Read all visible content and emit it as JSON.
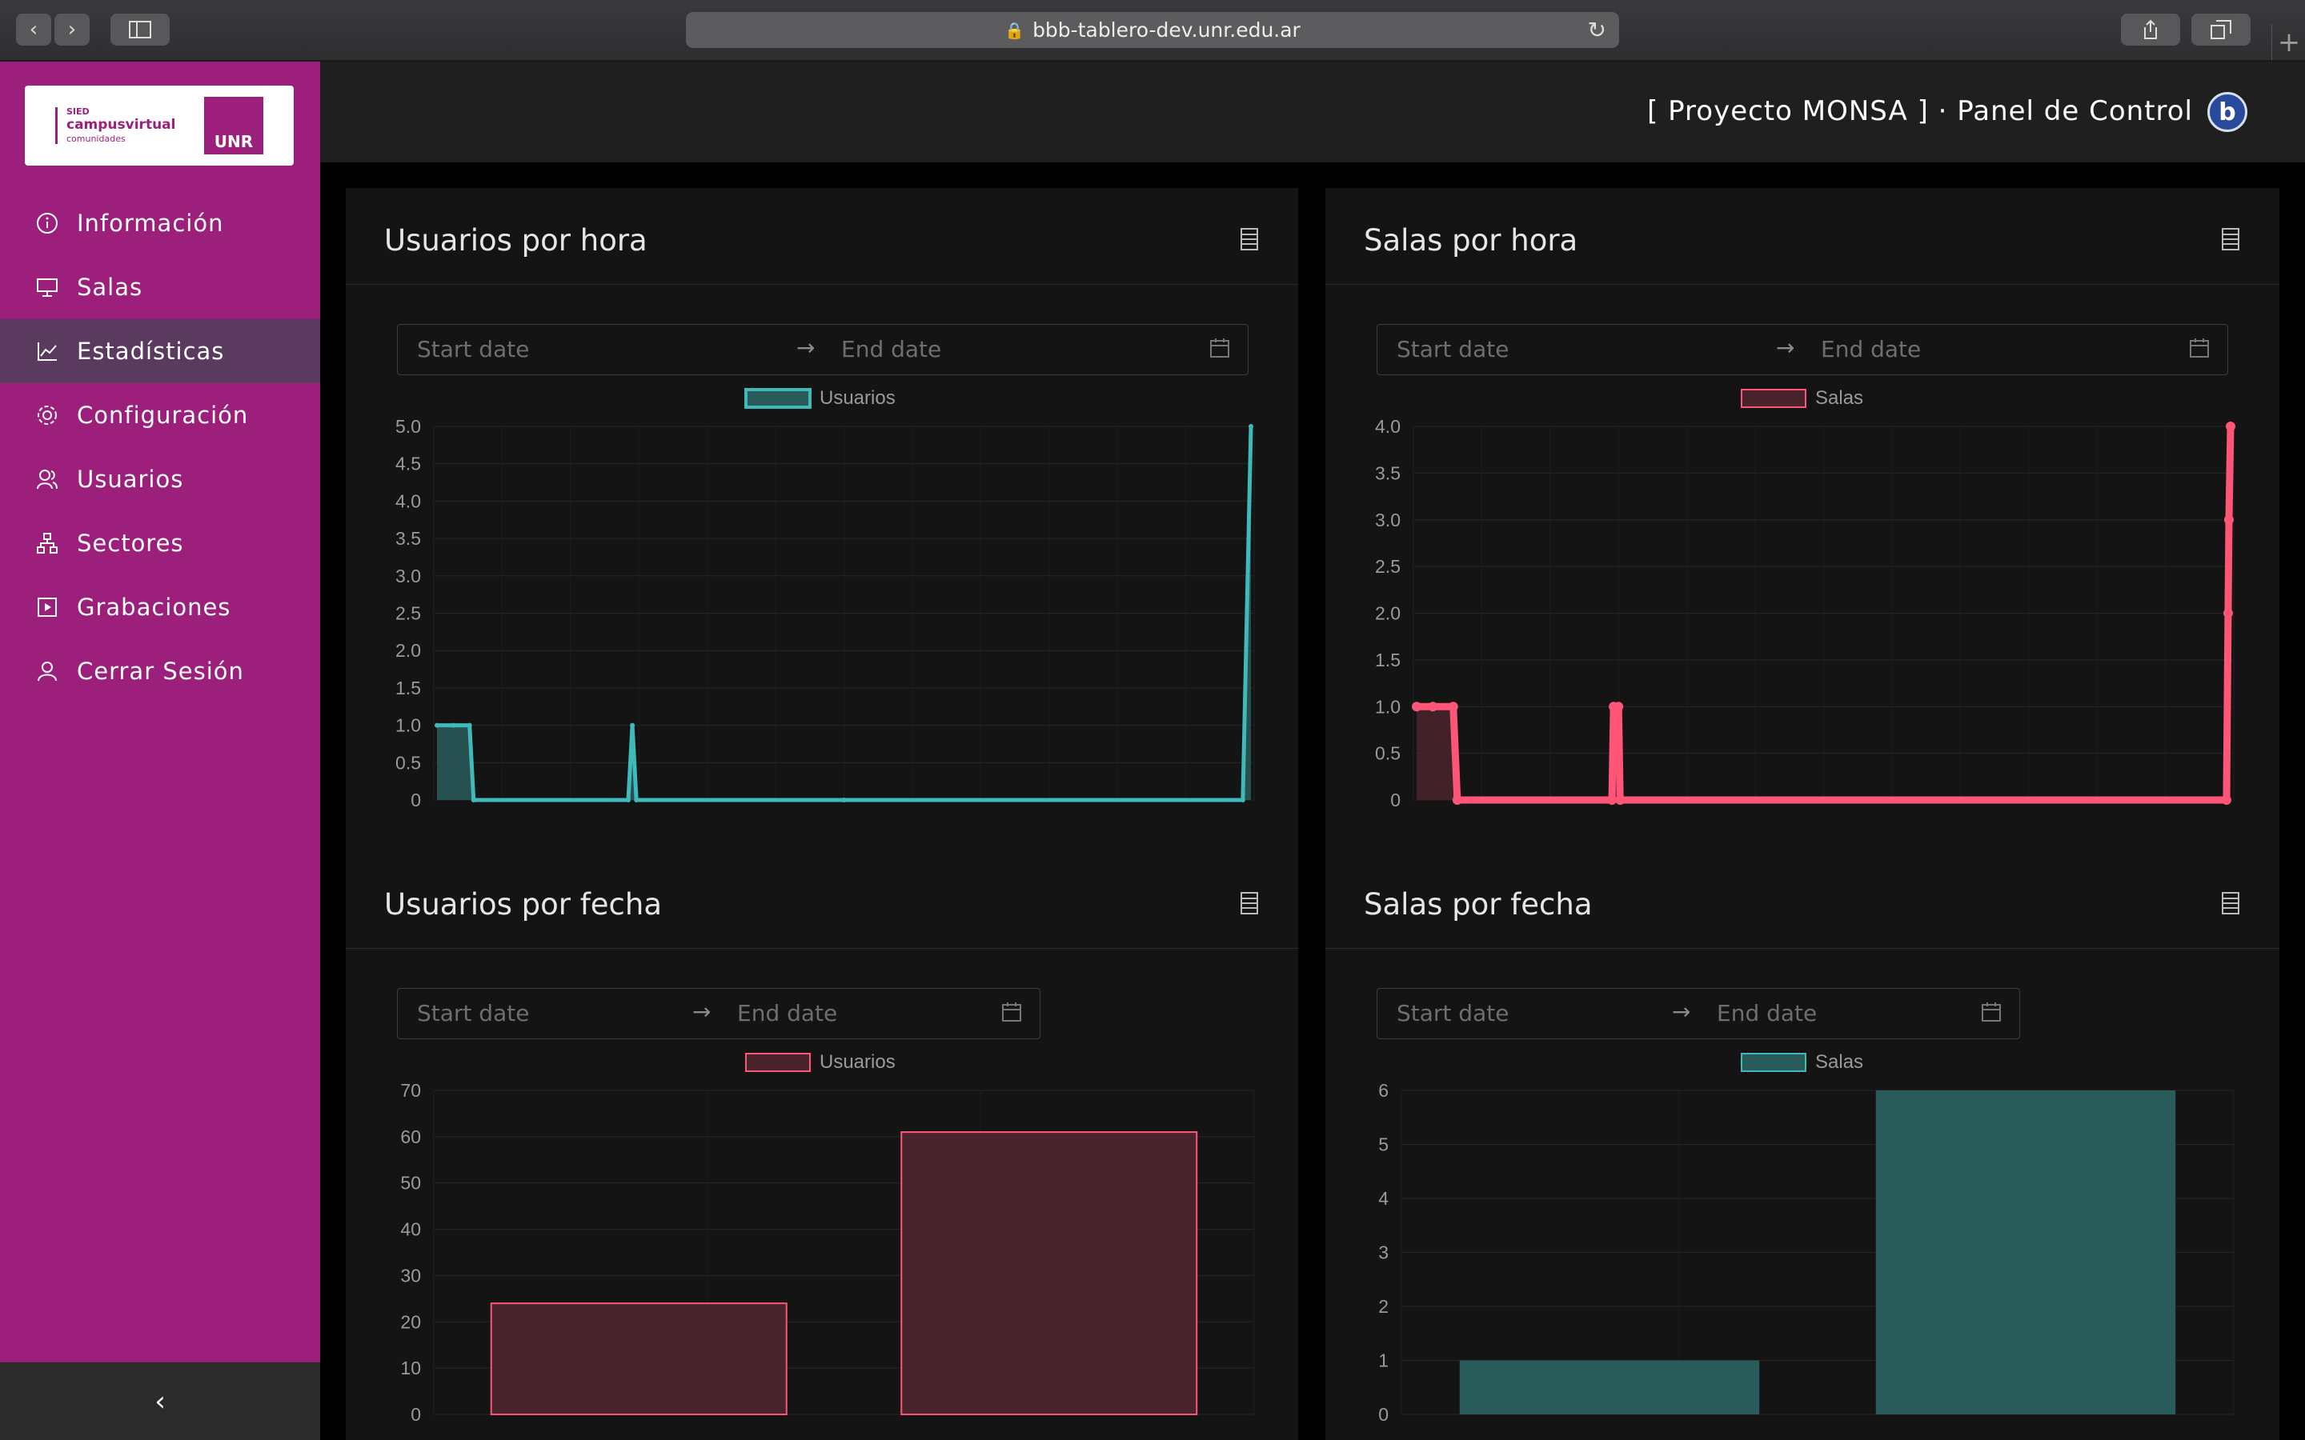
{
  "browser": {
    "url": "bbb-tablero-dev.unr.edu.ar"
  },
  "sidebar": {
    "logo": {
      "line1": "SIED",
      "line2": "campusvirtual",
      "line3": "comunidades",
      "brand": "UNR"
    },
    "items": [
      {
        "label": "Información",
        "icon": "info-icon"
      },
      {
        "label": "Salas",
        "icon": "monitor-icon"
      },
      {
        "label": "Estadísticas",
        "icon": "line-chart-icon",
        "active": true
      },
      {
        "label": "Configuración",
        "icon": "gear-icon"
      },
      {
        "label": "Usuarios",
        "icon": "users-icon"
      },
      {
        "label": "Sectores",
        "icon": "sitemap-icon"
      },
      {
        "label": "Grabaciones",
        "icon": "play-square-icon"
      },
      {
        "label": "Cerrar Sesión",
        "icon": "user-icon"
      }
    ],
    "collapse_label": "‹"
  },
  "header": {
    "title": "[ Proyecto MONSA ] · Panel de Control",
    "logo_letter": "b"
  },
  "date_range": {
    "start_placeholder": "Start date",
    "end_placeholder": "End date",
    "separator": "→"
  },
  "cards": [
    {
      "title": "Usuarios por hora"
    },
    {
      "title": "Salas por hora"
    },
    {
      "title": "Usuarios por fecha"
    },
    {
      "title": "Salas por fecha"
    }
  ],
  "colors": {
    "sidebar": "#9c1f7c",
    "teal": "#3fb9b9",
    "pink": "#ff5577",
    "teal_fill": "#2a5b5b",
    "pink_fill": "#4a242c"
  },
  "chart_data": [
    {
      "type": "line",
      "series": [
        {
          "name": "Usuarios",
          "values": [
            1,
            1,
            1,
            0,
            0,
            1,
            0,
            0,
            0,
            5
          ]
        }
      ],
      "x": [
        0,
        0.02,
        0.04,
        0.045,
        0.235,
        0.24,
        0.245,
        0.5,
        0.99,
        1
      ],
      "ylim": [
        0,
        5
      ],
      "yticks": [
        "0",
        "0.5",
        "1.0",
        "1.5",
        "2.0",
        "2.5",
        "3.0",
        "3.5",
        "4.0",
        "4.5",
        "5.0"
      ],
      "legend": "top",
      "grid": true
    },
    {
      "type": "line",
      "series": [
        {
          "name": "Salas",
          "values": [
            1,
            1,
            1,
            0,
            0,
            1,
            1,
            0,
            0,
            2,
            3,
            4
          ]
        }
      ],
      "x": [
        0,
        0.02,
        0.045,
        0.05,
        0.24,
        0.242,
        0.248,
        0.25,
        0.995,
        0.997,
        0.998,
        1
      ],
      "ylim": [
        0,
        4
      ],
      "yticks": [
        "0",
        "0.5",
        "1.0",
        "1.5",
        "2.0",
        "2.5",
        "3.0",
        "3.5",
        "4.0"
      ],
      "legend": "top",
      "grid": true
    },
    {
      "type": "bar",
      "categories": [
        "",
        ""
      ],
      "series": [
        {
          "name": "Usuarios",
          "values": [
            24,
            61
          ]
        }
      ],
      "ylim": [
        0,
        70
      ],
      "yticks": [
        "0",
        "10",
        "20",
        "30",
        "40",
        "50",
        "60",
        "70"
      ],
      "legend": "top",
      "grid": true
    },
    {
      "type": "bar",
      "categories": [
        "",
        ""
      ],
      "series": [
        {
          "name": "Salas",
          "values": [
            1,
            6
          ]
        }
      ],
      "ylim": [
        0,
        6
      ],
      "yticks": [
        "0",
        "1",
        "2",
        "3",
        "4",
        "5",
        "6"
      ],
      "legend": "top",
      "grid": true
    }
  ]
}
